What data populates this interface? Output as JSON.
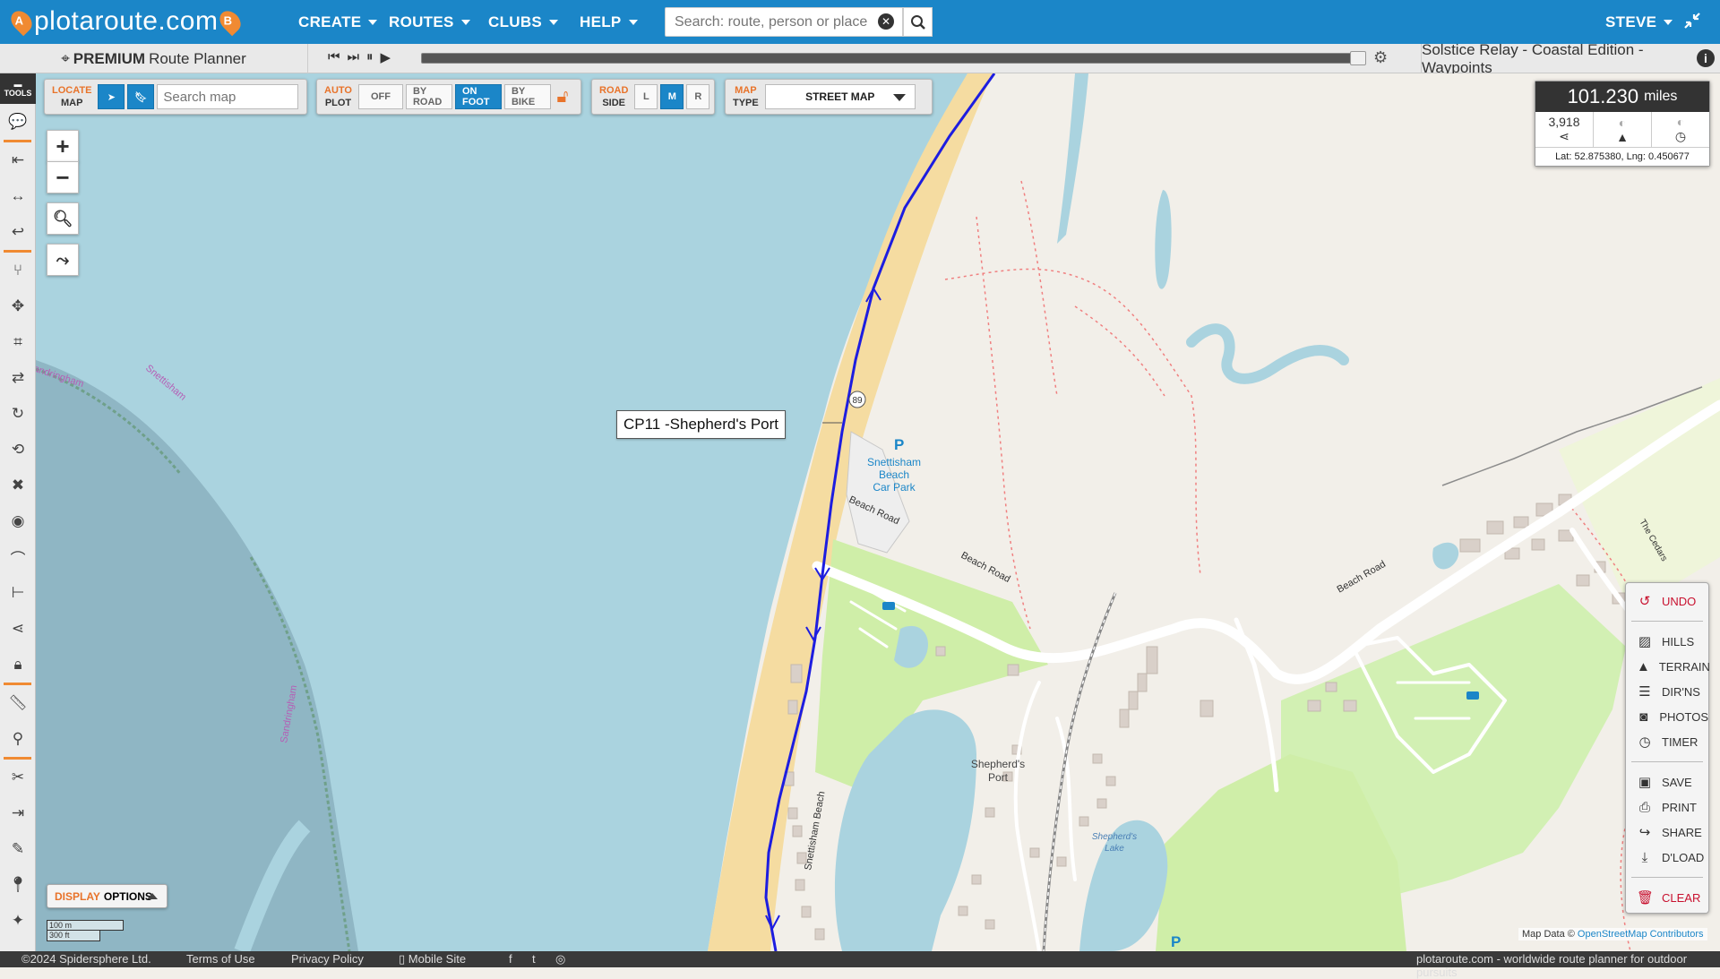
{
  "nav": {
    "logo": {
      "left_badge": "A",
      "text": "plotaroute.com",
      "right_badge": "B"
    },
    "menus": [
      {
        "label": "CREATE"
      },
      {
        "label": "ROUTES"
      },
      {
        "label": "CLUBS"
      },
      {
        "label": "HELP"
      }
    ],
    "search_placeholder": "Search: route, person or place",
    "user": "STEVE"
  },
  "subbar": {
    "premium_bold": "PREMIUM",
    "premium_rest": "Route Planner",
    "route_title": "Solstice Relay - Coastal Edition - Waypoints",
    "playback_progress": 1.0
  },
  "controls": {
    "locate": {
      "l1": "LOCATE",
      "l2": "MAP",
      "search_placeholder": "Search map"
    },
    "autoplot": {
      "l1": "AUTO",
      "l2": "PLOT",
      "options": [
        "OFF",
        "BY ROAD",
        "ON FOOT",
        "BY BIKE"
      ],
      "selected": "ON FOOT"
    },
    "roadside": {
      "l1": "ROAD",
      "l2": "SIDE",
      "options": [
        "L",
        "M",
        "R"
      ],
      "selected": "M"
    },
    "maptype": {
      "l1": "MAP",
      "l2": "TYPE",
      "value": "STREET MAP"
    }
  },
  "toolbar": {
    "tools_label": "TOOLS"
  },
  "stats": {
    "distance": "101.230",
    "unit": "miles",
    "count": "3,918",
    "coords": "Lat: 52.875380, Lng: 0.450677"
  },
  "waypoint_label": "CP11 -Shepherd's Port",
  "map_labels": {
    "road_number": "89",
    "car_park": [
      "Snettisham",
      "Beach",
      "Car Park"
    ],
    "beach_road_1": "Beach Road",
    "beach_road_2": "Beach Road",
    "beach_road_3": "Beach Road",
    "snettisham_beach": "Snettisham Beach",
    "shepherds_port": [
      "Shepherd's",
      "Port"
    ],
    "shepherds_lake": [
      "Shepherd's",
      "Lake"
    ],
    "the_cedars": "The Cedars",
    "sandringham_1": "Sandringham",
    "snettisham_2": "Snettisham",
    "sandringham_3": "Sandringham",
    "parking": "P"
  },
  "sidemenu": {
    "items": [
      {
        "label": "UNDO",
        "icon": "undo-icon"
      },
      {
        "label": "HILLS",
        "icon": "hills-icon"
      },
      {
        "label": "TERRAIN",
        "icon": "terrain-icon"
      },
      {
        "label": "DIR'NS",
        "icon": "directions-icon"
      },
      {
        "label": "PHOTOS",
        "icon": "camera-icon"
      },
      {
        "label": "TIMER",
        "icon": "timer-icon"
      },
      {
        "label": "SAVE",
        "icon": "save-icon"
      },
      {
        "label": "PRINT",
        "icon": "print-icon"
      },
      {
        "label": "SHARE",
        "icon": "share-icon"
      },
      {
        "label": "D'LOAD",
        "icon": "download-icon"
      },
      {
        "label": "CLEAR",
        "icon": "trash-icon"
      }
    ]
  },
  "display_options": {
    "o": "DISPLAY",
    "rest": "OPTIONS"
  },
  "scale": {
    "metric": "100 m",
    "imperial": "300 ft"
  },
  "attribution": {
    "prefix": "Map Data ©",
    "link": "OpenStreetMap Contributors"
  },
  "footer": {
    "copyright": "©2024 Spidersphere Ltd.",
    "terms": "Terms of Use",
    "privacy": "Privacy Policy",
    "mobile": "Mobile Site",
    "tagline": "plotaroute.com - worldwide route planner for outdoor pursuits"
  },
  "colors": {
    "brand": "#1b86c8",
    "accent": "#f08a32",
    "route": "#1d1de0"
  }
}
